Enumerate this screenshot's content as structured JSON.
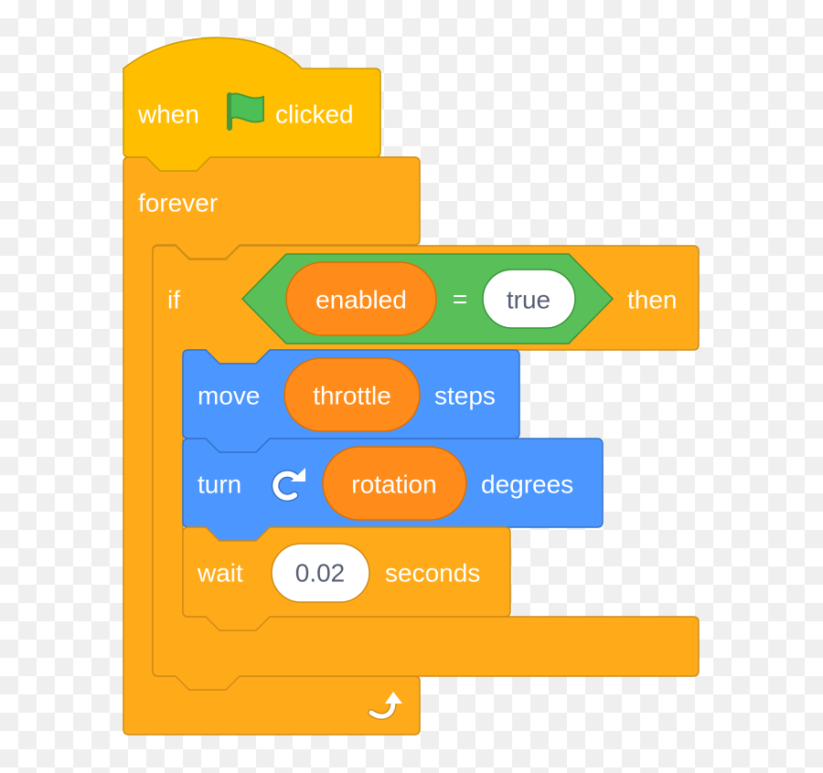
{
  "colors": {
    "events": "#FFBF00",
    "control": "#FFAB19",
    "motion": "#4C97FF",
    "operators": "#59C059",
    "variables": "#FF8C1A",
    "input": "#FFFFFF"
  },
  "script": {
    "hat": {
      "when": "when",
      "flag_icon": "green-flag-icon",
      "clicked": "clicked"
    },
    "forever": {
      "label": "forever",
      "loop_icon": "loop-arrow-icon"
    },
    "if": {
      "if_label": "if",
      "then_label": "then",
      "condition": {
        "left": "enabled",
        "operator": "=",
        "right": "true"
      }
    },
    "move": {
      "label": "move",
      "value": "throttle",
      "suffix": "steps"
    },
    "turn": {
      "label": "turn",
      "icon": "rotate-clockwise-icon",
      "value": "rotation",
      "suffix": "degrees"
    },
    "wait": {
      "label": "wait",
      "value": "0.02",
      "suffix": "seconds"
    }
  }
}
